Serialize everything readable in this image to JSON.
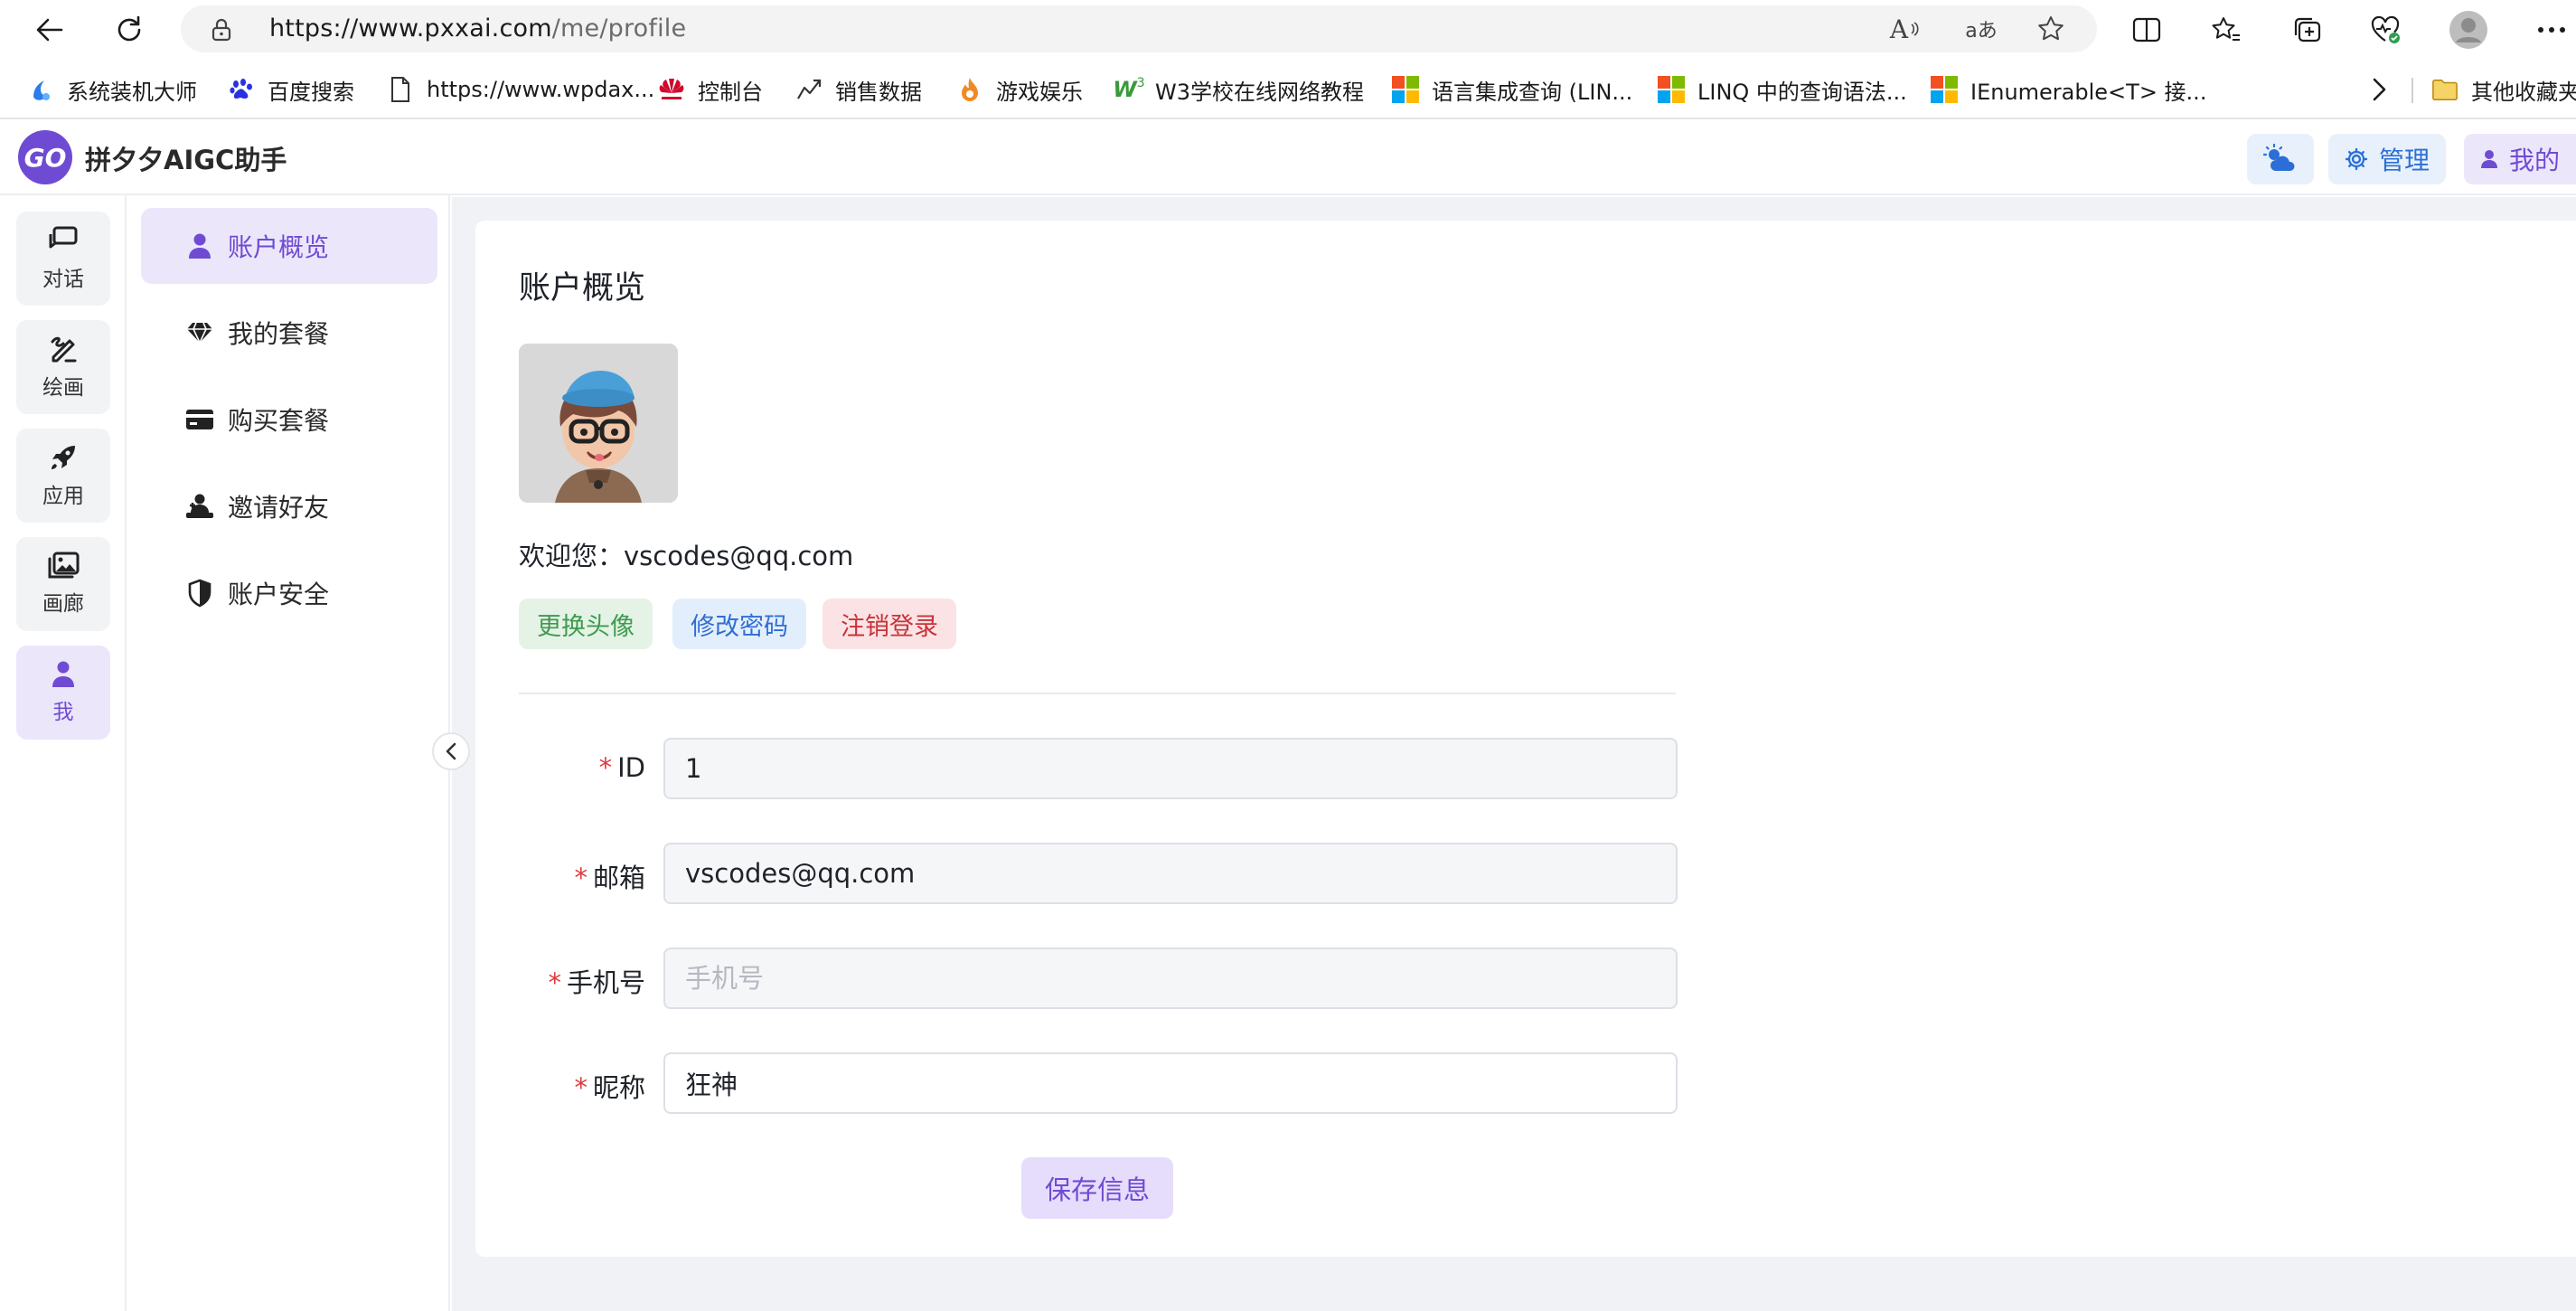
{
  "browser": {
    "url_host": "https://www.pxxai.com",
    "url_path": "/me/profile",
    "read_aloud_label": "A",
    "translate_label": "aあ",
    "bookmarks": [
      {
        "label": "系统装机大师",
        "icon": "bookmark-blue-swirl-icon"
      },
      {
        "label": "百度搜索",
        "icon": "baidu-paw-icon"
      },
      {
        "label": "https://www.wpdax...",
        "icon": "page-icon"
      },
      {
        "label": "控制台",
        "icon": "huawei-icon"
      },
      {
        "label": "销售数据",
        "icon": "chart-icon"
      },
      {
        "label": "游戏娱乐",
        "icon": "flame-icon"
      },
      {
        "label": "W3学校在线网络教程",
        "icon": "w3-icon"
      },
      {
        "label": "语言集成查询 (LIN...",
        "icon": "microsoft-icon"
      },
      {
        "label": "LINQ 中的查询语法...",
        "icon": "microsoft-icon"
      },
      {
        "label": "IEnumerable<T> 接...",
        "icon": "microsoft-icon"
      }
    ],
    "other_bookmarks": "其他收藏夹",
    "colors": {
      "ms_red": "#f25022",
      "ms_green": "#7fba00",
      "ms_blue": "#00a4ef",
      "ms_yellow": "#ffb900"
    }
  },
  "app": {
    "logo_text": "GO",
    "name": "拼夕夕AIGC助手",
    "header_buttons": {
      "weather_icon": "weather-icon",
      "admin": "管理",
      "me": "我的"
    },
    "accent": "#6f4bd3"
  },
  "rail": [
    {
      "label": "对话",
      "icon": "chat-icon",
      "active": false
    },
    {
      "label": "绘画",
      "icon": "brush-icon",
      "active": false
    },
    {
      "label": "应用",
      "icon": "rocket-icon",
      "active": false
    },
    {
      "label": "画廊",
      "icon": "gallery-icon",
      "active": false
    },
    {
      "label": "我",
      "icon": "user-icon",
      "active": true
    }
  ],
  "submenu": [
    {
      "label": "账户概览",
      "icon": "user-icon",
      "active": true
    },
    {
      "label": "我的套餐",
      "icon": "diamond-icon",
      "active": false
    },
    {
      "label": "购买套餐",
      "icon": "credit-card-icon",
      "active": false
    },
    {
      "label": "邀请好友",
      "icon": "invite-icon",
      "active": false
    },
    {
      "label": "账户安全",
      "icon": "shield-icon",
      "active": false
    }
  ],
  "profile": {
    "title": "账户概览",
    "welcome": "欢迎您：vscodes@qq.com",
    "actions": {
      "change_avatar": "更换头像",
      "change_password": "修改密码",
      "logout": "注销登录"
    },
    "form": {
      "id_label": "ID",
      "id_value": "1",
      "email_label": "邮箱",
      "email_value": "vscodes@qq.com",
      "phone_label": "手机号",
      "phone_value": "",
      "phone_placeholder": "手机号",
      "nickname_label": "昵称",
      "nickname_value": "狂神",
      "required_mark": "*"
    },
    "save_label": "保存信息"
  }
}
